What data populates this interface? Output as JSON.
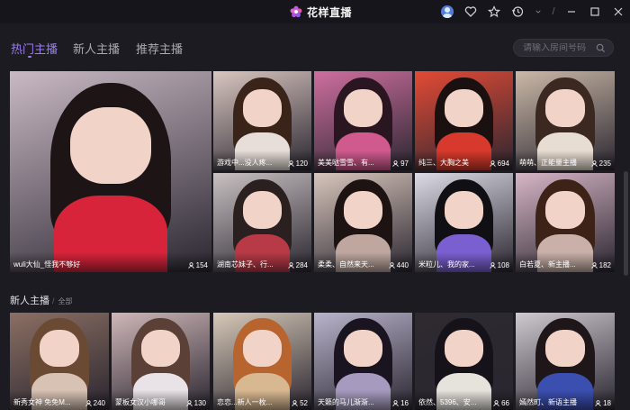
{
  "app": {
    "title": "花样直播"
  },
  "titlebar": {
    "separator": "/",
    "icons": [
      "avatar-icon",
      "heart-icon",
      "star-icon",
      "history-icon",
      "dropdown-icon",
      "minimize-icon",
      "maximize-icon",
      "close-icon"
    ]
  },
  "nav": {
    "tabs": [
      {
        "label": "热门主播",
        "active": true
      },
      {
        "label": "新人主播",
        "active": false
      },
      {
        "label": "推荐主播",
        "active": false
      }
    ]
  },
  "search": {
    "placeholder": "请输入房间号码"
  },
  "hot": [
    {
      "caption": "wuli大仙_怪我不够好",
      "count": "154"
    },
    {
      "caption": "游戏中...没人疼...",
      "count": "120"
    },
    {
      "caption": "美美哒雪雪、有...",
      "count": "97"
    },
    {
      "caption": "纯三、大胸之美",
      "count": "694"
    },
    {
      "caption": "萌萌、正能量主播",
      "count": "235"
    },
    {
      "caption": "湖南芯妹子、行...",
      "count": "284"
    },
    {
      "caption": "柔柔、自然来天...",
      "count": "440"
    },
    {
      "caption": "米粒儿、我的家...",
      "count": "108"
    },
    {
      "caption": "白若夏、新主播...",
      "count": "182"
    }
  ],
  "new_section": {
    "title": "新人主播",
    "all_label": "全部",
    "separator": "/"
  },
  "new": [
    {
      "caption": "新秀女神 免免M...",
      "count": "240"
    },
    {
      "caption": "蒙板女汉小哪哥",
      "count": "130"
    },
    {
      "caption": "恋恋...新人一枚...",
      "count": "52"
    },
    {
      "caption": "天籁的马儿渐渐...",
      "count": "16"
    },
    {
      "caption": "依然、5396、安...",
      "count": "66"
    },
    {
      "caption": "嫣然町、新语主播",
      "count": "18"
    }
  ]
}
